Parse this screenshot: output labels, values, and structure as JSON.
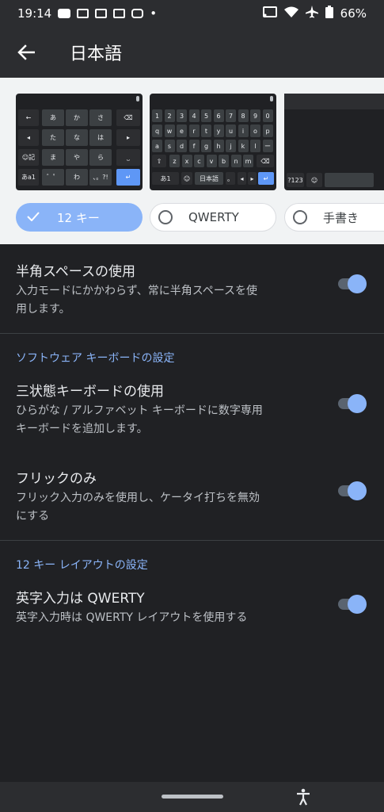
{
  "status_bar": {
    "time": "19:14",
    "dot": "•",
    "battery": "66%"
  },
  "app_bar": {
    "title": "日本語"
  },
  "layouts": {
    "pills": [
      {
        "label": "12 キー",
        "selected": true
      },
      {
        "label": "QWERTY",
        "selected": false
      },
      {
        "label": "手書き",
        "selected": false
      }
    ],
    "kb12": {
      "rows": [
        [
          "←",
          "あ",
          "か",
          "さ",
          "⌫"
        ],
        [
          "◂",
          "た",
          "な",
          "は",
          "▸"
        ],
        [
          "☺記",
          "ま",
          "や",
          "ら",
          "⎵"
        ],
        [
          "あa1",
          "゛゜",
          "わ",
          "、。?!",
          "↵"
        ]
      ]
    },
    "kbqwerty": {
      "row1": [
        "1",
        "2",
        "3",
        "4",
        "5",
        "6",
        "7",
        "8",
        "9",
        "0"
      ],
      "row2": [
        "q",
        "w",
        "e",
        "r",
        "t",
        "y",
        "u",
        "i",
        "o",
        "p"
      ],
      "row3": [
        "a",
        "s",
        "d",
        "f",
        "g",
        "h",
        "j",
        "k",
        "l",
        "ー"
      ],
      "row4": [
        "⇧",
        "z",
        "x",
        "c",
        "v",
        "b",
        "n",
        "m",
        "⌫"
      ],
      "row5": [
        "あ1",
        "☺",
        "日本語",
        "。",
        "◂",
        "▸",
        "↵"
      ]
    },
    "kbhand": {
      "k1": "?123",
      "k2": "☺"
    }
  },
  "settings": {
    "half_space": {
      "title": "半角スペースの使用",
      "line1": "入力モードにかかわらず、常に半角スペースを使",
      "line2": "用します。",
      "enabled": true
    },
    "software_header": "ソフトウェア キーボードの設定",
    "tri_state": {
      "title": "三状態キーボードの使用",
      "line1": "ひらがな / アルファベット キーボードに数字専用",
      "line2": "キーボードを追加します。",
      "enabled": true
    },
    "flick_only": {
      "title": "フリックのみ",
      "line1": "フリック入力のみを使用し、ケータイ打ちを無効",
      "line2": "にする",
      "enabled": true
    },
    "layout12_header": "12 キー レイアウトの設定",
    "qwerty_alpha": {
      "title": "英字入力は QWERTY",
      "line1": "英字入力時は QWERTY レイアウトを使用する",
      "enabled": true
    }
  },
  "colors": {
    "accent": "#8ab4f8",
    "background": "#202124",
    "surface": "#2c2d30"
  }
}
